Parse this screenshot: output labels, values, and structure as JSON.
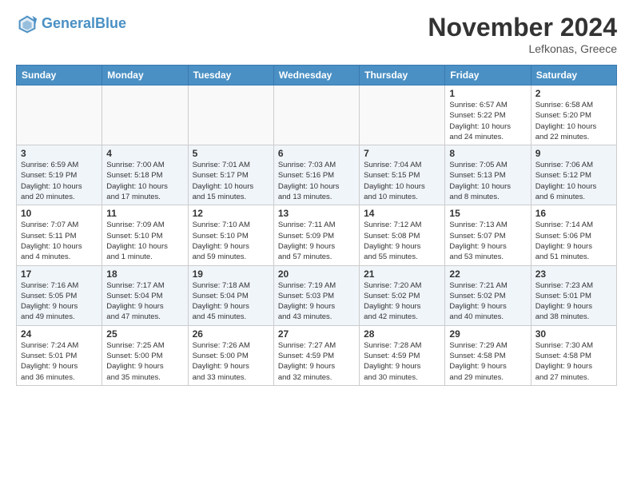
{
  "header": {
    "logo_line1": "General",
    "logo_line2": "Blue",
    "month": "November 2024",
    "location": "Lefkonas, Greece"
  },
  "weekdays": [
    "Sunday",
    "Monday",
    "Tuesday",
    "Wednesday",
    "Thursday",
    "Friday",
    "Saturday"
  ],
  "weeks": [
    [
      {
        "day": "",
        "info": ""
      },
      {
        "day": "",
        "info": ""
      },
      {
        "day": "",
        "info": ""
      },
      {
        "day": "",
        "info": ""
      },
      {
        "day": "",
        "info": ""
      },
      {
        "day": "1",
        "info": "Sunrise: 6:57 AM\nSunset: 5:22 PM\nDaylight: 10 hours\nand 24 minutes."
      },
      {
        "day": "2",
        "info": "Sunrise: 6:58 AM\nSunset: 5:20 PM\nDaylight: 10 hours\nand 22 minutes."
      }
    ],
    [
      {
        "day": "3",
        "info": "Sunrise: 6:59 AM\nSunset: 5:19 PM\nDaylight: 10 hours\nand 20 minutes."
      },
      {
        "day": "4",
        "info": "Sunrise: 7:00 AM\nSunset: 5:18 PM\nDaylight: 10 hours\nand 17 minutes."
      },
      {
        "day": "5",
        "info": "Sunrise: 7:01 AM\nSunset: 5:17 PM\nDaylight: 10 hours\nand 15 minutes."
      },
      {
        "day": "6",
        "info": "Sunrise: 7:03 AM\nSunset: 5:16 PM\nDaylight: 10 hours\nand 13 minutes."
      },
      {
        "day": "7",
        "info": "Sunrise: 7:04 AM\nSunset: 5:15 PM\nDaylight: 10 hours\nand 10 minutes."
      },
      {
        "day": "8",
        "info": "Sunrise: 7:05 AM\nSunset: 5:13 PM\nDaylight: 10 hours\nand 8 minutes."
      },
      {
        "day": "9",
        "info": "Sunrise: 7:06 AM\nSunset: 5:12 PM\nDaylight: 10 hours\nand 6 minutes."
      }
    ],
    [
      {
        "day": "10",
        "info": "Sunrise: 7:07 AM\nSunset: 5:11 PM\nDaylight: 10 hours\nand 4 minutes."
      },
      {
        "day": "11",
        "info": "Sunrise: 7:09 AM\nSunset: 5:10 PM\nDaylight: 10 hours\nand 1 minute."
      },
      {
        "day": "12",
        "info": "Sunrise: 7:10 AM\nSunset: 5:10 PM\nDaylight: 9 hours\nand 59 minutes."
      },
      {
        "day": "13",
        "info": "Sunrise: 7:11 AM\nSunset: 5:09 PM\nDaylight: 9 hours\nand 57 minutes."
      },
      {
        "day": "14",
        "info": "Sunrise: 7:12 AM\nSunset: 5:08 PM\nDaylight: 9 hours\nand 55 minutes."
      },
      {
        "day": "15",
        "info": "Sunrise: 7:13 AM\nSunset: 5:07 PM\nDaylight: 9 hours\nand 53 minutes."
      },
      {
        "day": "16",
        "info": "Sunrise: 7:14 AM\nSunset: 5:06 PM\nDaylight: 9 hours\nand 51 minutes."
      }
    ],
    [
      {
        "day": "17",
        "info": "Sunrise: 7:16 AM\nSunset: 5:05 PM\nDaylight: 9 hours\nand 49 minutes."
      },
      {
        "day": "18",
        "info": "Sunrise: 7:17 AM\nSunset: 5:04 PM\nDaylight: 9 hours\nand 47 minutes."
      },
      {
        "day": "19",
        "info": "Sunrise: 7:18 AM\nSunset: 5:04 PM\nDaylight: 9 hours\nand 45 minutes."
      },
      {
        "day": "20",
        "info": "Sunrise: 7:19 AM\nSunset: 5:03 PM\nDaylight: 9 hours\nand 43 minutes."
      },
      {
        "day": "21",
        "info": "Sunrise: 7:20 AM\nSunset: 5:02 PM\nDaylight: 9 hours\nand 42 minutes."
      },
      {
        "day": "22",
        "info": "Sunrise: 7:21 AM\nSunset: 5:02 PM\nDaylight: 9 hours\nand 40 minutes."
      },
      {
        "day": "23",
        "info": "Sunrise: 7:23 AM\nSunset: 5:01 PM\nDaylight: 9 hours\nand 38 minutes."
      }
    ],
    [
      {
        "day": "24",
        "info": "Sunrise: 7:24 AM\nSunset: 5:01 PM\nDaylight: 9 hours\nand 36 minutes."
      },
      {
        "day": "25",
        "info": "Sunrise: 7:25 AM\nSunset: 5:00 PM\nDaylight: 9 hours\nand 35 minutes."
      },
      {
        "day": "26",
        "info": "Sunrise: 7:26 AM\nSunset: 5:00 PM\nDaylight: 9 hours\nand 33 minutes."
      },
      {
        "day": "27",
        "info": "Sunrise: 7:27 AM\nSunset: 4:59 PM\nDaylight: 9 hours\nand 32 minutes."
      },
      {
        "day": "28",
        "info": "Sunrise: 7:28 AM\nSunset: 4:59 PM\nDaylight: 9 hours\nand 30 minutes."
      },
      {
        "day": "29",
        "info": "Sunrise: 7:29 AM\nSunset: 4:58 PM\nDaylight: 9 hours\nand 29 minutes."
      },
      {
        "day": "30",
        "info": "Sunrise: 7:30 AM\nSunset: 4:58 PM\nDaylight: 9 hours\nand 27 minutes."
      }
    ]
  ]
}
